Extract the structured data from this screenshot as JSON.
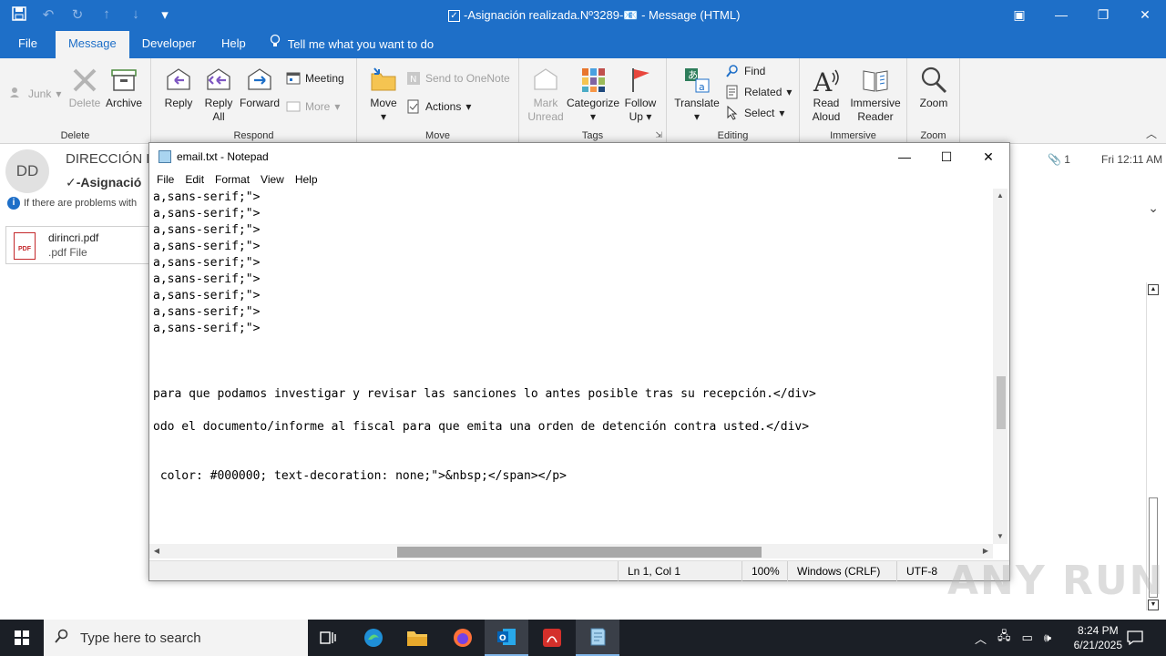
{
  "outlook": {
    "title": "-Asignación realizada.Nº3289-📧  -  Message (HTML)",
    "tabs": [
      "File",
      "Message",
      "Developer",
      "Help"
    ],
    "tell_me": "Tell me what you want to do"
  },
  "ribbon": {
    "delete": {
      "group": "Delete",
      "junk": "Junk",
      "delete": "Delete",
      "archive": "Archive"
    },
    "respond": {
      "group": "Respond",
      "reply": "Reply",
      "reply_all_1": "Reply",
      "reply_all_2": "All",
      "forward": "Forward",
      "meeting": "Meeting",
      "more": "More"
    },
    "move": {
      "group": "Move",
      "move": "Move",
      "onenote": "Send to OneNote",
      "actions": "Actions"
    },
    "tags": {
      "group": "Tags",
      "mark_1": "Mark",
      "mark_2": "Unread",
      "categorize": "Categorize",
      "follow_1": "Follow",
      "follow_2": "Up"
    },
    "editing": {
      "group": "Editing",
      "translate": "Translate",
      "find": "Find",
      "related": "Related",
      "select": "Select"
    },
    "immersive": {
      "group": "Immersive",
      "read_1": "Read",
      "read_2": "Aloud",
      "imm_1": "Immersive",
      "imm_2": "Reader"
    },
    "zoom": {
      "group": "Zoom",
      "zoom": "Zoom"
    }
  },
  "message": {
    "avatar": "DD",
    "sender": "DIRECCIÓN D",
    "subject": "✓-Asignació",
    "info": "If there are problems with",
    "attachment_name": "dirincri.pdf",
    "attachment_type": ".pdf File",
    "attachment_count": "1",
    "date": "Fri 12:11 AM"
  },
  "notepad": {
    "title": "email.txt - Notepad",
    "menu": [
      "File",
      "Edit",
      "Format",
      "View",
      "Help"
    ],
    "lines": [
      "a,sans-serif;\">",
      "a,sans-serif;\">",
      "a,sans-serif;\">",
      "a,sans-serif;\">",
      "a,sans-serif;\">",
      "a,sans-serif;\">",
      "a,sans-serif;\">",
      "a,sans-serif;\">",
      "a,sans-serif;\">",
      "para que podamos investigar y revisar las sanciones lo antes posible tras su recepción.</div>",
      "odo el documento/informe al fiscal para que emita una orden de detención contra usted.</div>",
      " color: #000000; text-decoration: none;\">&nbsp;</span></p>"
    ],
    "status": {
      "pos": "Ln 1, Col 1",
      "zoom": "100%",
      "eol": "Windows (CRLF)",
      "enc": "UTF-8"
    }
  },
  "watermark": "ANY RUN",
  "taskbar": {
    "search": "Type here to search",
    "time": "8:24 PM",
    "date": "6/21/2025"
  }
}
